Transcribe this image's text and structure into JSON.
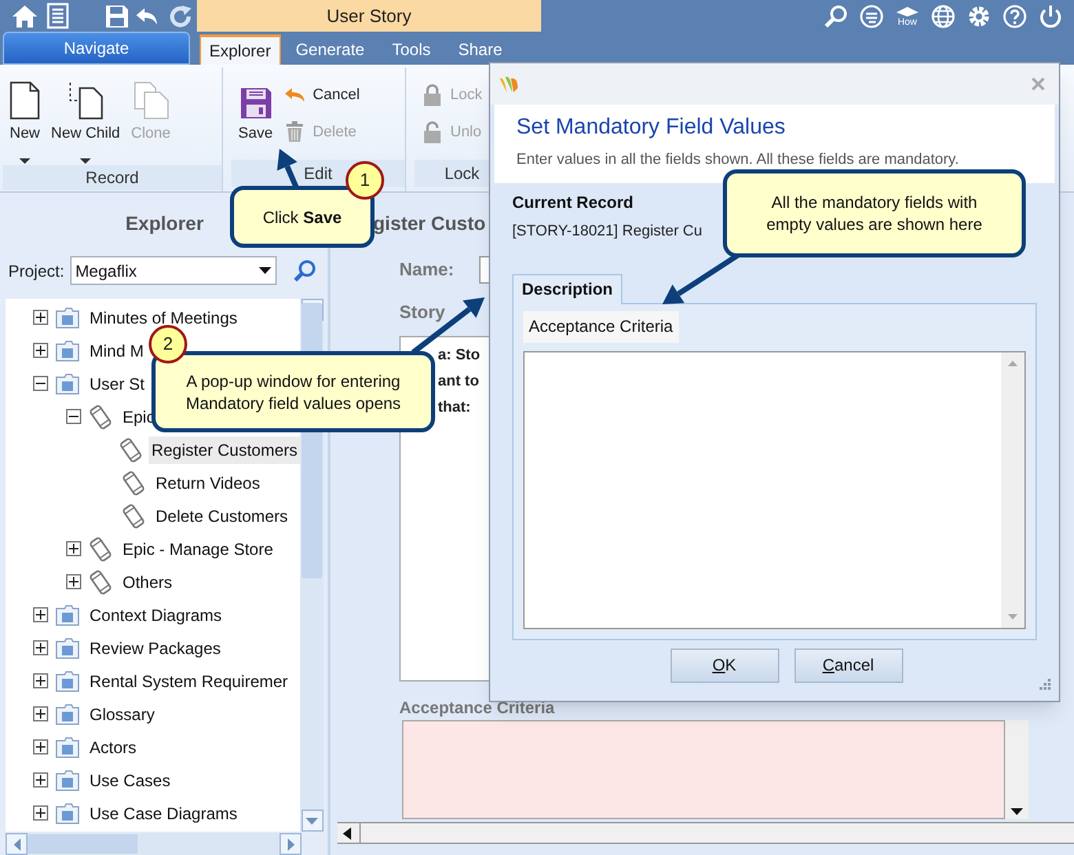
{
  "top_bar": {
    "context_title": "User Story",
    "how_label": "How"
  },
  "navigate_button": "Navigate",
  "tabs": [
    {
      "label": "Explorer",
      "selected": true
    },
    {
      "label": "Generate",
      "selected": false
    },
    {
      "label": "Tools",
      "selected": false
    },
    {
      "label": "Share",
      "selected": false
    }
  ],
  "ribbon": {
    "groups": [
      {
        "label": "Record",
        "buttons": [
          {
            "label": "New",
            "kind": "new",
            "dropdown": true,
            "disabled": false
          },
          {
            "label": "New Child",
            "kind": "newchild",
            "dropdown": true,
            "disabled": false
          },
          {
            "label": "Clone",
            "kind": "clone",
            "dropdown": false,
            "disabled": true
          }
        ]
      },
      {
        "label": "Edit",
        "buttons": [
          {
            "label": "Save",
            "kind": "save",
            "dropdown": false,
            "disabled": false
          },
          {
            "label": "Cancel",
            "kind": "cancel",
            "dropdown": false,
            "disabled": false
          },
          {
            "label": "Delete",
            "kind": "delete",
            "dropdown": false,
            "disabled": true
          }
        ]
      },
      {
        "label": "Lock",
        "buttons": [
          {
            "label": "Lock",
            "kind": "lock",
            "dropdown": false,
            "disabled": true
          },
          {
            "label": "Unlo",
            "kind": "unlock",
            "dropdown": false,
            "disabled": true
          }
        ]
      }
    ]
  },
  "explorer": {
    "title": "Explorer",
    "project_label": "Project:",
    "project_value": "Megaflix",
    "tree": [
      {
        "label": "Minutes of Meetings",
        "kind": "folder",
        "expanded": false,
        "selected": false
      },
      {
        "label": "Mind M",
        "kind": "folder",
        "expanded": false,
        "selected": false
      },
      {
        "label": "User St",
        "kind": "folder",
        "expanded": true,
        "selected": false,
        "children": [
          {
            "label": "Epic",
            "kind": "epic",
            "expanded": true,
            "selected": false,
            "children": [
              {
                "label": "Register Customers",
                "kind": "story",
                "selected": true
              },
              {
                "label": "Return Videos",
                "kind": "story",
                "selected": false
              },
              {
                "label": "Delete Customers",
                "kind": "story",
                "selected": false
              }
            ]
          },
          {
            "label": "Epic - Manage Store",
            "kind": "epic",
            "expanded": false,
            "selected": false
          },
          {
            "label": "Others",
            "kind": "epic",
            "expanded": false,
            "selected": false
          }
        ]
      },
      {
        "label": "Context Diagrams",
        "kind": "folder",
        "expanded": false,
        "selected": false
      },
      {
        "label": "Review Packages",
        "kind": "folder",
        "expanded": false,
        "selected": false
      },
      {
        "label": "Rental System Requiremer",
        "kind": "folder",
        "expanded": false,
        "selected": false
      },
      {
        "label": "Glossary",
        "kind": "folder",
        "expanded": false,
        "selected": false
      },
      {
        "label": "Actors",
        "kind": "folder",
        "expanded": false,
        "selected": false
      },
      {
        "label": "Use Cases",
        "kind": "folder",
        "expanded": false,
        "selected": false
      },
      {
        "label": "Use Case Diagrams",
        "kind": "folder",
        "expanded": false,
        "selected": false
      }
    ]
  },
  "record": {
    "title": "gister Custo",
    "name_label": "Name:",
    "story_label": "Story",
    "story_lines": [
      "a: Sto",
      "ant to",
      "that:"
    ],
    "acceptance_label": "Acceptance Criteria"
  },
  "dialog": {
    "title": "Set Mandatory Field Values",
    "subtitle": "Enter values in all the fields shown. All these fields are mandatory.",
    "current_record_label": "Current Record",
    "current_record_value": "[STORY-18021] Register Cu",
    "tabs": [
      {
        "label": "Description",
        "selected": true
      }
    ],
    "field_label": "Acceptance Criteria",
    "buttons": [
      "OK",
      "Cancel"
    ]
  },
  "callouts": [
    {
      "badge": "1",
      "text": "Click **Save**"
    },
    {
      "badge": "2",
      "text": "A pop-up window for entering Mandatory field values opens"
    },
    {
      "text": "All the mandatory fields with empty values are shown here"
    }
  ]
}
